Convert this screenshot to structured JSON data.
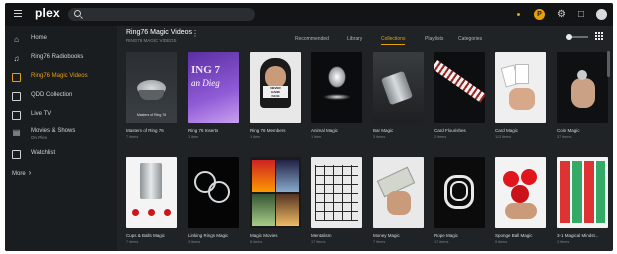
{
  "topbar": {
    "logo_text": "plex",
    "search_placeholder": "",
    "premium_badge": "P"
  },
  "sidebar": {
    "items": [
      {
        "label": "Home",
        "sub": "",
        "icon": "home-icon"
      },
      {
        "label": "Ring76 Radiobooks",
        "sub": "",
        "icon": "music-icon"
      },
      {
        "label": "Ring76 Magic Videos",
        "sub": "",
        "icon": "video-icon"
      },
      {
        "label": "QDD Collection",
        "sub": "",
        "icon": "video-icon"
      },
      {
        "label": "Live TV",
        "sub": "",
        "icon": "tv-icon"
      },
      {
        "label": "Movies & Shows",
        "sub": "On Plex",
        "icon": "film-icon"
      },
      {
        "label": "Watchlist",
        "sub": "",
        "icon": "bookmark-icon"
      }
    ],
    "more_label": "More",
    "active_index": 2
  },
  "library": {
    "title": "Ring76 Magic Videos",
    "subtitle": "RING76 MAGIC VIDEOS",
    "tabs": [
      "Recommended",
      "Library",
      "Collections",
      "Playlists",
      "Categories"
    ],
    "active_tab": "Collections"
  },
  "collections": [
    {
      "title": "Masters of Ring 76",
      "count": "7 items",
      "caption": "Masters of Ring 76",
      "thumb": "speaker"
    },
    {
      "title": "Ring 76 Inserts",
      "count": "1 item",
      "caption": "",
      "thumb": "poster-purple"
    },
    {
      "title": "Ring 76 Members",
      "count": "1 item",
      "caption": "",
      "thumb": "face-card"
    },
    {
      "title": "Animal Magic",
      "count": "1 item",
      "caption": "",
      "thumb": "dark-splash"
    },
    {
      "title": "Bar Magic",
      "count": "3 items",
      "caption": "",
      "thumb": "glass"
    },
    {
      "title": "Card Flourishes",
      "count": "2 items",
      "caption": "",
      "thumb": "card-spread"
    },
    {
      "title": "Card Magic",
      "count": "113 items",
      "caption": "",
      "thumb": "cards-hand"
    },
    {
      "title": "Coin Magic",
      "count": "37 items",
      "caption": "",
      "thumb": "coin-hand"
    },
    {
      "title": "Cups & Balls Magic",
      "count": "7 items",
      "caption": "",
      "thumb": "cups"
    },
    {
      "title": "Linking Rings Magic",
      "count": "3 items",
      "caption": "",
      "thumb": "rings"
    },
    {
      "title": "Magic Movies",
      "count": "8 items",
      "caption": "",
      "thumb": "posters"
    },
    {
      "title": "Mentalism",
      "count": "17 items",
      "caption": "",
      "thumb": "grid-cards"
    },
    {
      "title": "Money Magic",
      "count": "7 items",
      "caption": "",
      "thumb": "bills"
    },
    {
      "title": "Rope Magic",
      "count": "17 items",
      "caption": "",
      "thumb": "rope"
    },
    {
      "title": "Sponge Ball Magic",
      "count": "5 items",
      "caption": "",
      "thumb": "sponge"
    },
    {
      "title": "3-1 Magical Mindst...",
      "count": "3 items",
      "caption": "",
      "thumb": "card-grid"
    }
  ],
  "colors": {
    "accent": "#e5a00d",
    "background": "#1f2326",
    "sidebar": "#1a1d20",
    "topbar": "#121416"
  }
}
